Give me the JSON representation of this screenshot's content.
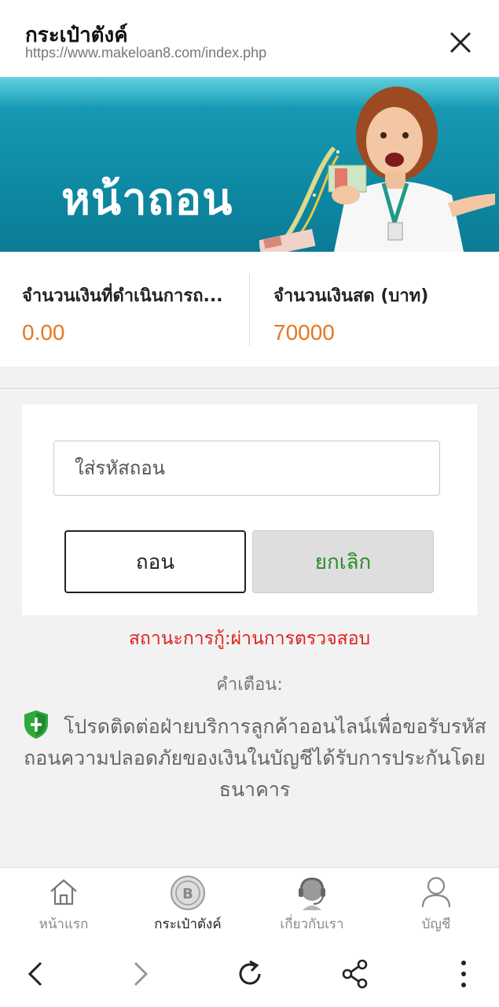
{
  "browser": {
    "title": "กระเป๋าตังค์",
    "url": "https://www.makeloan8.com/index.php",
    "close_icon": "close-icon"
  },
  "banner": {
    "title": "หน้าถอน"
  },
  "amounts": {
    "processing_label": "จำนวนเงินที่ดำเนินการถ...",
    "processing_value": "0.00",
    "cash_label": "จำนวนเงินสด (บาท)",
    "cash_value": "70000"
  },
  "form": {
    "code_placeholder": "ใส่รหัสถอน",
    "withdraw_label": "ถอน",
    "cancel_label": "ยกเลิก"
  },
  "status_text": "สถานะการกู้:ผ่านการตรวจสอบ",
  "warning": {
    "title": "คำเตือน:",
    "text": "โปรดติดต่อฝ่ายบริการลูกค้าออนไลน์เพื่อขอรับรหัสถอนความปลอดภัยของเงินในบัญชีได้รับการประกันโดยธนาคาร",
    "icon": "shield-icon"
  },
  "tabs": [
    {
      "label": "หน้าแรก",
      "icon": "home-icon"
    },
    {
      "label": "กระเป๋าตังค์",
      "icon": "baht-coin-icon",
      "active": true
    },
    {
      "label": "เกี่ยวกับเรา",
      "icon": "support-agent-icon"
    },
    {
      "label": "บัญชี",
      "icon": "user-icon"
    }
  ],
  "colors": {
    "accent_orange": "#e8761f",
    "status_red": "#e02020",
    "cancel_green": "#2a8a2a",
    "banner_teal": "#1a9fb8"
  }
}
